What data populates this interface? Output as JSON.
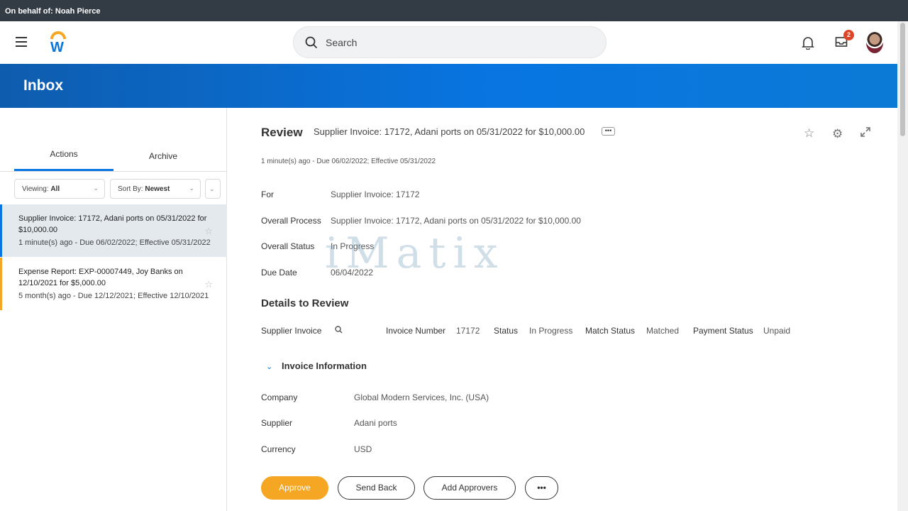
{
  "topbar": {
    "on_behalf": "On behalf of: Noah Pierce"
  },
  "header": {
    "search_placeholder": "Search",
    "inbox_badge": "2",
    "icons": [
      "menu-icon",
      "workday-logo",
      "search-icon",
      "bell-icon",
      "inbox-icon",
      "user-avatar"
    ]
  },
  "banner": {
    "title": "Inbox"
  },
  "left": {
    "tabs": [
      {
        "label": "Actions"
      },
      {
        "label": "Archive"
      }
    ],
    "filters": {
      "viewing_label": "Viewing:",
      "viewing_value": "All",
      "sort_label": "Sort By:",
      "sort_value": "Newest"
    },
    "items": [
      {
        "title": "Supplier Invoice: 17172, Adani ports on 05/31/2022 for $10,000.00",
        "meta": "1 minute(s) ago - Due 06/02/2022; Effective 05/31/2022"
      },
      {
        "title": "Expense Report: EXP-00007449, Joy Banks on 12/10/2021 for $5,000.00",
        "meta": "5 month(s) ago - Due 12/12/2021; Effective 12/10/2021"
      }
    ]
  },
  "main": {
    "review_label": "Review",
    "title": "Supplier Invoice: 17172, Adani ports on 05/31/2022 for $10,000.00",
    "more_label": "•••",
    "subtitle": "1 minute(s) ago - Due 06/02/2022; Effective 05/31/2022",
    "fields": [
      {
        "label": "For",
        "value": "Supplier Invoice: 17172"
      },
      {
        "label": "Overall Process",
        "value": "Supplier Invoice: 17172, Adani ports on 05/31/2022 for $10,000.00"
      },
      {
        "label": "Overall Status",
        "value": "In Progress"
      },
      {
        "label": "Due Date",
        "value": "06/04/2022"
      }
    ],
    "details_heading": "Details to Review",
    "details_row": {
      "supplier_invoice_label": "Supplier Invoice",
      "invoice_number_label": "Invoice Number",
      "invoice_number": "17172",
      "status_label": "Status",
      "status": "In Progress",
      "match_status_label": "Match Status",
      "match_status": "Matched",
      "payment_status_label": "Payment Status",
      "payment_status": "Unpaid"
    },
    "invoice_info_heading": "Invoice Information",
    "invoice_info": [
      {
        "label": "Company",
        "value": "Global Modern Services, Inc. (USA)"
      },
      {
        "label": "Supplier",
        "value": "Adani ports"
      },
      {
        "label": "Currency",
        "value": "USD"
      }
    ],
    "buttons": {
      "approve": "Approve",
      "send_back": "Send Back",
      "add_approvers": "Add Approvers",
      "more": "•••"
    }
  },
  "watermark": "iMatix",
  "colors": {
    "topbar": "#333c45",
    "banner": "#0875e1",
    "approve": "#f5a623",
    "badge": "#de4526"
  }
}
